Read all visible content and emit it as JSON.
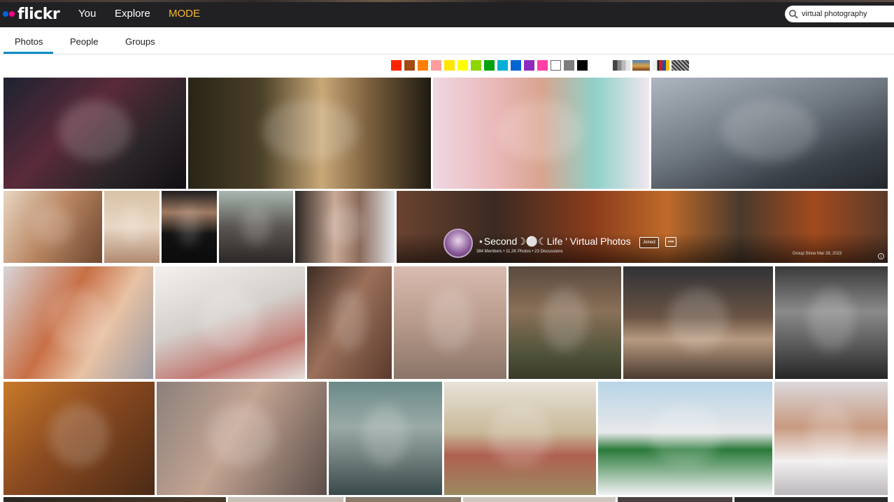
{
  "nav": {
    "logo_text": "flickr",
    "links": [
      "You",
      "Explore",
      "MODE"
    ],
    "mode_color": "#f5b82b"
  },
  "search": {
    "value": "virtual photography",
    "icon": "search-icon"
  },
  "tabs": {
    "items": [
      "Photos",
      "People",
      "Groups"
    ],
    "active": "Photos",
    "accent": "#0a8bc7"
  },
  "color_filters": [
    {
      "name": "red",
      "color": "#ff2400"
    },
    {
      "name": "dark-orange",
      "color": "#a14a11"
    },
    {
      "name": "orange",
      "color": "#ff7f00"
    },
    {
      "name": "pink",
      "color": "#ff9c9c"
    },
    {
      "name": "yellow",
      "color": "#ffe500"
    },
    {
      "name": "lemon",
      "color": "#ffff00"
    },
    {
      "name": "lime",
      "color": "#8ed600"
    },
    {
      "name": "green",
      "color": "#00a30f"
    },
    {
      "name": "cyan",
      "color": "#00b0d8"
    },
    {
      "name": "blue",
      "color": "#0064d3"
    },
    {
      "name": "violet",
      "color": "#8d2bbf"
    },
    {
      "name": "magenta",
      "color": "#ff3ea8"
    },
    {
      "name": "white",
      "color": "#ffffff"
    },
    {
      "name": "gray",
      "color": "#7d7d7d"
    },
    {
      "name": "black",
      "color": "#000000"
    }
  ],
  "style_filters": [
    "black-and-white",
    "shallow-depth-of-field",
    "minimalist",
    "patterns"
  ],
  "group_banner": {
    "name": "⋆Second☽⚪☾Life ' Virtual Photos",
    "meta": "384 Members • 11.2K Photos • 23 Discussions",
    "joined_label": "Joined",
    "more_label": "•••",
    "since": "Group Since Mar 28, 2023"
  }
}
